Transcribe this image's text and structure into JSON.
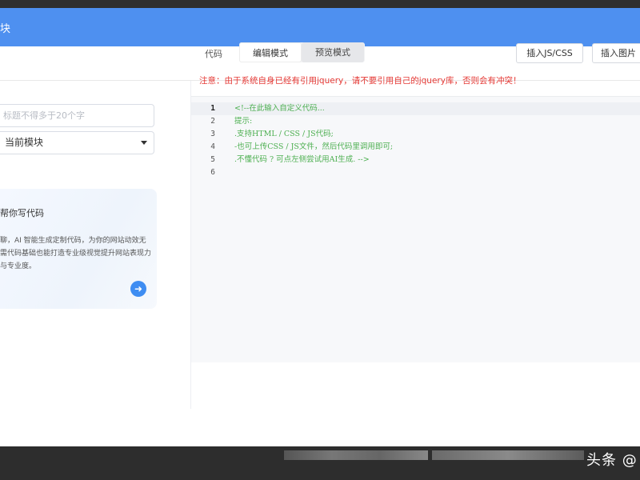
{
  "header": {
    "title": "块"
  },
  "left": {
    "title_placeholder": "标题不得多于20个字",
    "module_select": {
      "selected": "当前模块"
    },
    "ai_card": {
      "title": "帮你写代码",
      "description": "聊，AI 智能生成定制代码，为你的网站动效无需代码基础也能打造专业级视觉提升网站表现力与专业度。",
      "arrow_icon": "arrow-right-icon"
    }
  },
  "editor_toolbar": {
    "code_label": "代码",
    "tabs": [
      {
        "label": "编辑模式",
        "active": true
      },
      {
        "label": "预览模式",
        "active": false
      }
    ],
    "insert_js_css": "插入JS/CSS",
    "insert_image": "插入图片"
  },
  "warning": "注意：由于系统自身已经有引用jquery，请不要引用自己的jquery库，否则会有冲突！",
  "editor": {
    "line_numbers": [
      "1",
      "2",
      "3",
      "4",
      "5",
      "6"
    ],
    "lines": [
      "<!--在此输入自定义代码...",
      "提示:",
      ".支持HTML / CSS / JS代码;",
      "-也可上传CSS / JS文件，然后代码里调用即可;",
      ".不懂代码 ? 可点左侧尝试用AI生成. -->",
      ""
    ]
  },
  "watermark": "头条 @",
  "colors": {
    "header": "#4e90f0",
    "accent": "#3e8df2",
    "warning": "#e53935",
    "code": "#4caf50"
  }
}
